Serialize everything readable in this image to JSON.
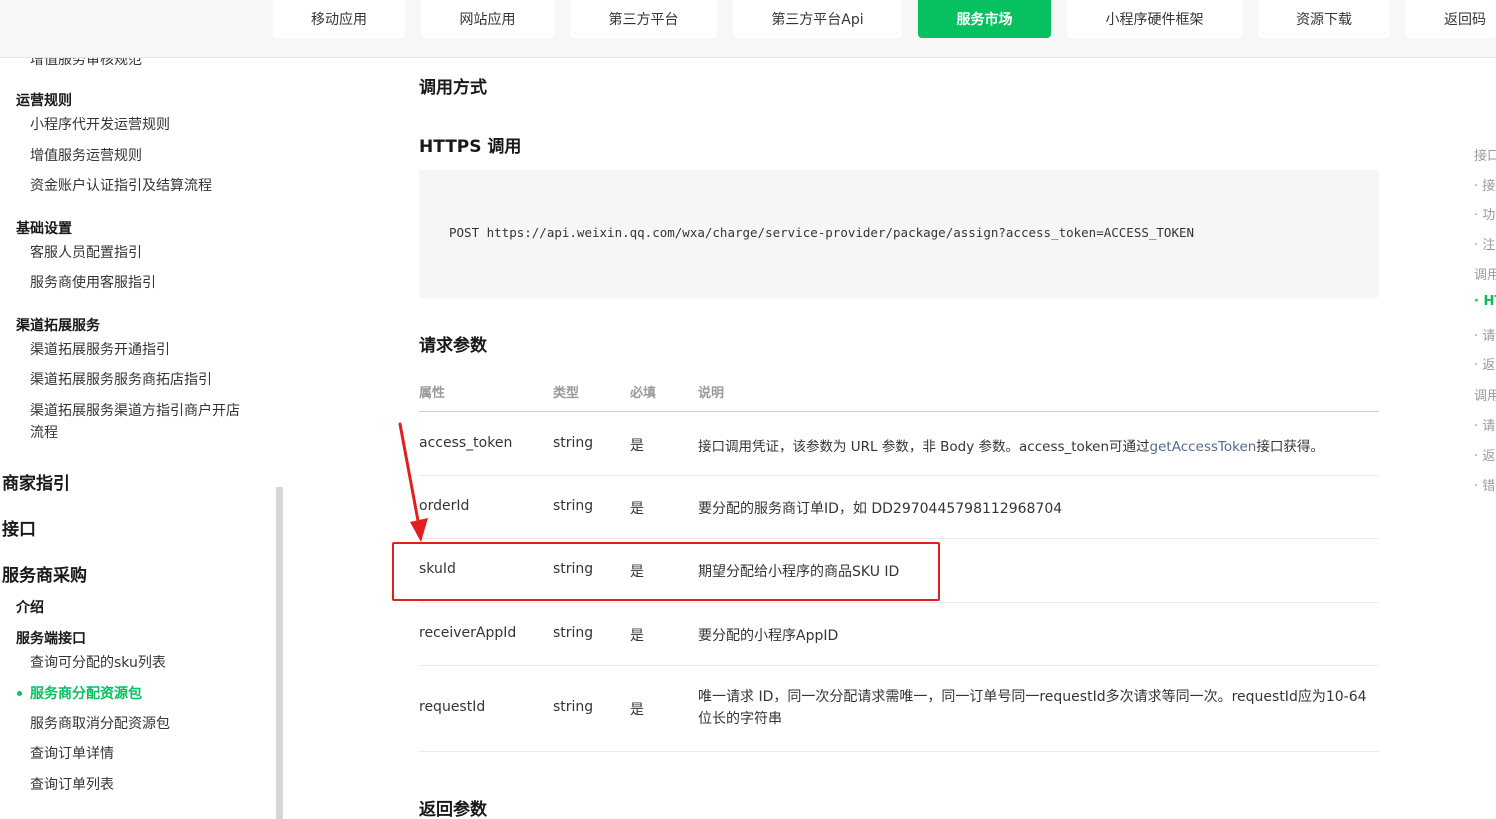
{
  "nav": {
    "tabs": [
      "移动应用",
      "网站应用",
      "第三方平台",
      "第三方平台Api",
      "服务市场",
      "小程序硬件框架",
      "资源下载",
      "返回码"
    ],
    "active_tab": "服务市场"
  },
  "sidebar": {
    "cut_top": "增值服务审核规范",
    "ops_group": "运营规则",
    "ops_items": [
      "小程序代开发运营规则",
      "增值服务运营规则",
      "资金账户认证指引及结算流程"
    ],
    "basic_group": "基础设置",
    "basic_items": [
      "客服人员配置指引",
      "服务商使用客服指引"
    ],
    "channel_group": "渠道拓展服务",
    "channel_items": [
      "渠道拓展服务开通指引",
      "渠道拓展服务服务商拓店指引",
      "渠道拓展服务渠道方指引商户开店",
      "流程"
    ],
    "major1": "商家指引",
    "major2": "接口",
    "major3": "服务商采购",
    "intro": "介绍",
    "server_group": "服务端接口",
    "server_items": [
      "查询可分配的sku列表",
      "服务商分配资源包",
      "服务商取消分配资源包",
      "查询订单详情",
      "查询订单列表"
    ],
    "active_item": "服务商分配资源包"
  },
  "main": {
    "call_heading": "调用方式",
    "https_heading": "HTTPS 调用",
    "code": "POST https://api.weixin.qq.com/wxa/charge/service-provider/package/assign?access_token=ACCESS_TOKEN",
    "params_heading": "请求参数",
    "columns": [
      "属性",
      "类型",
      "必填",
      "说明"
    ],
    "rows": [
      {
        "name": "access_token",
        "type": "string",
        "required": "是",
        "desc_pre": "接口调用凭证，该参数为 URL 参数，非 Body 参数。access_token可通过",
        "desc_link": "getAccessToken",
        "desc_post": "接口获得。"
      },
      {
        "name": "orderId",
        "type": "string",
        "required": "是",
        "desc": "要分配的服务商订单ID，如 DD2970445798112968704"
      },
      {
        "name": "skuId",
        "type": "string",
        "required": "是",
        "desc": "期望分配给小程序的商品SKU ID"
      },
      {
        "name": "receiverAppId",
        "type": "string",
        "required": "是",
        "desc": "要分配的小程序AppID"
      },
      {
        "name": "requestId",
        "type": "string",
        "required": "是",
        "desc": "唯一请求 ID，同一次分配请求需唯一，同一订单号同一requestId多次请求等同一次。requestId应为10-64位长的字符串"
      }
    ],
    "return_heading": "返回参数"
  },
  "toc": [
    "接口",
    "· 接",
    "· 功",
    "· 注",
    "调用",
    "· HT",
    "· 请",
    "· 返",
    "调用",
    "· 请",
    "· 返",
    "· 错"
  ],
  "toc_active_index": 5,
  "colors": {
    "accent": "#07c160",
    "annotation": "#e02020",
    "link": "#576b95"
  }
}
